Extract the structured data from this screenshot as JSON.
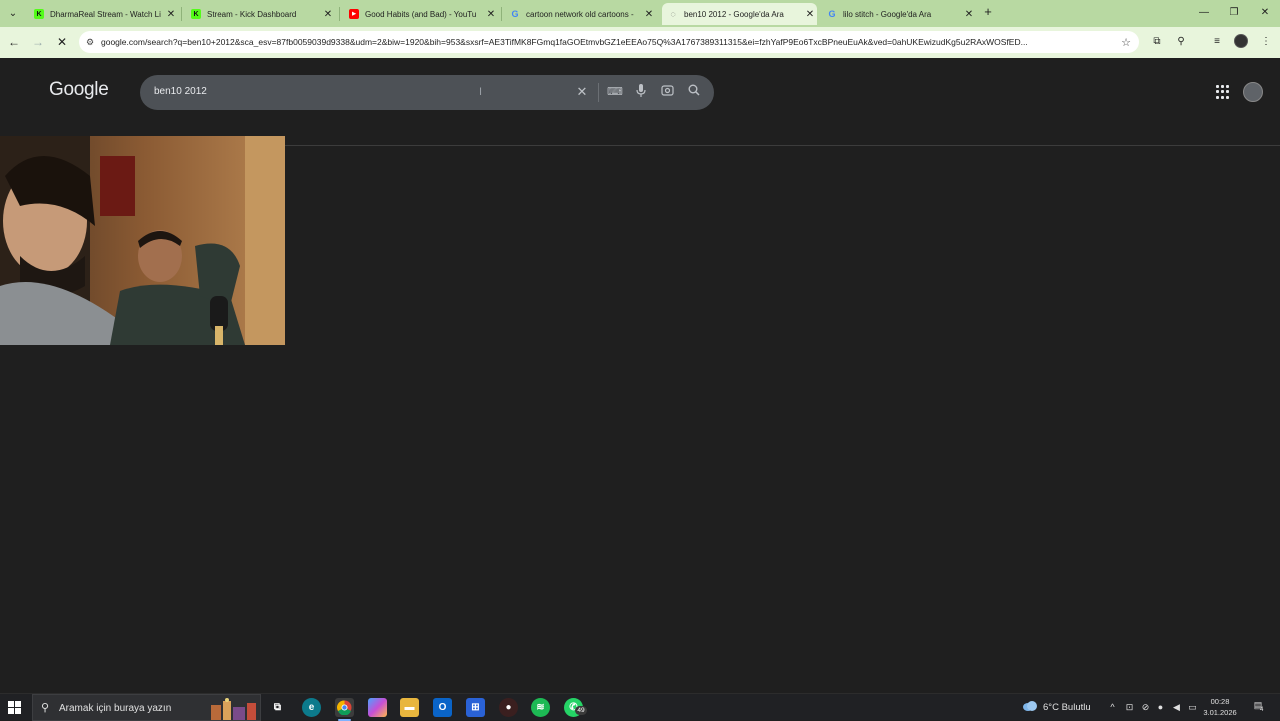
{
  "browser": {
    "tabs": [
      {
        "title": "DharmaReal Stream - Watch Li",
        "favicon": "kick-icon",
        "active": false
      },
      {
        "title": "Stream - Kick Dashboard",
        "favicon": "kick-icon",
        "active": false
      },
      {
        "title": "Good Habits (and Bad) - YouTu",
        "favicon": "youtube-icon",
        "active": false
      },
      {
        "title": "cartoon network old cartoons -",
        "favicon": "google-icon",
        "active": false
      },
      {
        "title": "ben10 2012 - Google'da Ara",
        "favicon": "loading-icon",
        "active": true
      },
      {
        "title": "lilo stitch - Google'da Ara",
        "favicon": "google-icon",
        "active": false
      }
    ],
    "tab_close": "✕",
    "new_tab": "+",
    "url": "google.com/search?q=ben10+2012&sca_esv=87fb0059039d9338&udm=2&biw=1920&bih=953&sxsrf=AE3TifMK8FGmq1faGOEtmvbGZ1eEEAo75Q%3A1767389311315&ei=fzhYafP9Eo6TxcBPneuEuAk&ved=0ahUKEwizudKg5u2RAxWOSfED...",
    "accent_color": "#b8d9a2"
  },
  "google": {
    "logo": "Google",
    "search_query": "ben10 2012"
  },
  "taskbar": {
    "search_placeholder": "Aramak için buraya yazın",
    "whatsapp_badge": "49",
    "weather": "6°C  Bulutlu",
    "time": "00:28",
    "date": "3.01.2026",
    "notification_count": "4"
  }
}
